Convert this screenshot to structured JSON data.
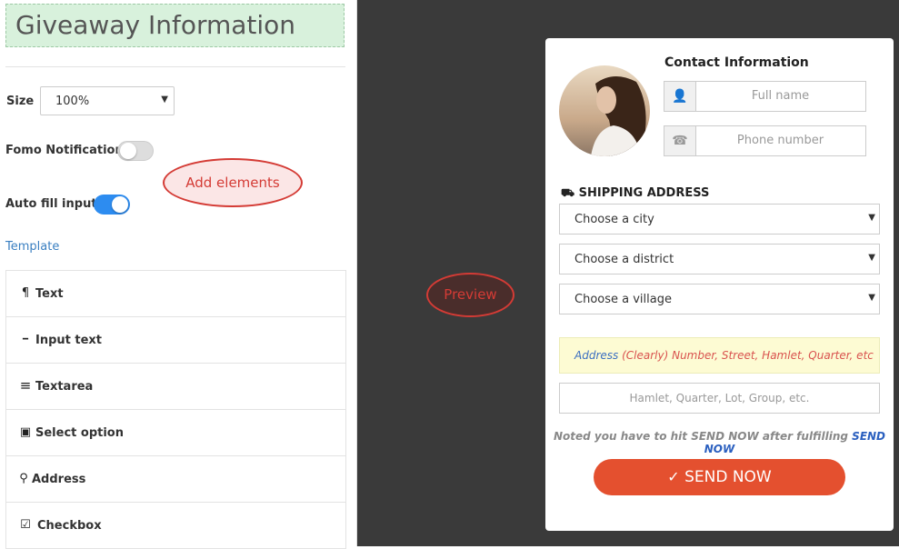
{
  "editor": {
    "title": "Giveaway Information",
    "size_label": "Size",
    "size_value": "100%",
    "fomo_label": "Fomo Notification",
    "fomo_on": false,
    "autofill_label": "Auto fill input",
    "autofill_on": true,
    "template_link": "Template",
    "elements": [
      {
        "icon": "paragraph-icon",
        "glyph": "¶",
        "label": "Text"
      },
      {
        "icon": "minus-icon",
        "glyph": "━",
        "label": "Input text"
      },
      {
        "icon": "align-left-icon",
        "glyph": "≡",
        "label": "Textarea"
      },
      {
        "icon": "dropdown-box-icon",
        "glyph": "▣",
        "label": "Select option"
      },
      {
        "icon": "map-pin-icon",
        "glyph": "⚲",
        "label": "Address"
      },
      {
        "icon": "checkbox-icon",
        "glyph": "☑",
        "label": "Checkbox"
      }
    ]
  },
  "annotations": {
    "add_elements": "Add elements",
    "preview": "Preview"
  },
  "preview": {
    "contact_title": "Contact Information",
    "fullname_placeholder": "Full name",
    "phone_placeholder": "Phone number",
    "shipping_title": "SHIPPING ADDRESS",
    "city": "Choose a city",
    "district": "Choose a district",
    "village": "Choose a village",
    "address_label": "Address",
    "address_hint": "(Clearly) Number, Street, Hamlet, Quarter, etc",
    "address_placeholder": "Hamlet, Quarter, Lot, Group, etc.",
    "note_text": "Noted you have to hit SEND NOW after fulfilling",
    "note_highlight": "SEND NOW",
    "send_button": "SEND NOW"
  },
  "colors": {
    "accent_blue": "#2d8cf0",
    "send_button": "#e4502f",
    "annotation_red": "#d43b35",
    "title_bg": "#d8f1dc"
  }
}
